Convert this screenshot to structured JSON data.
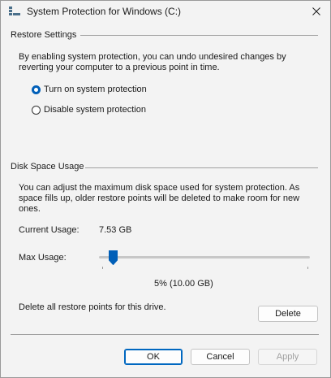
{
  "window": {
    "title": "System Protection for Windows (C:)",
    "accent_color": "#005fb8"
  },
  "restore_settings": {
    "header": "Restore Settings",
    "description": "By enabling system protection, you can undo undesired changes by reverting your computer to a previous point in time.",
    "options": [
      {
        "label": "Turn on system protection",
        "checked": true
      },
      {
        "label": "Disable system protection",
        "checked": false
      }
    ]
  },
  "disk_space": {
    "header": "Disk Space Usage",
    "description": "You can adjust the maximum disk space used for system protection. As space fills up, older restore points will be deleted to make room for new ones.",
    "current_usage_label": "Current Usage:",
    "current_usage_value": "7.53 GB",
    "max_usage_label": "Max Usage:",
    "max_usage_percent": 5,
    "max_usage_readout": "5% (10.00 GB)",
    "delete_text": "Delete all restore points for this drive.",
    "delete_label": "Delete"
  },
  "buttons": {
    "ok": "OK",
    "cancel": "Cancel",
    "apply": "Apply"
  },
  "icons": {
    "app": "system-protection-icon",
    "close": "close-icon",
    "slider_thumb": "slider-thumb"
  }
}
